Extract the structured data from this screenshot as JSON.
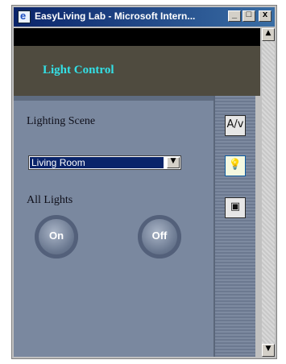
{
  "window": {
    "title": "EasyLiving Lab - Microsoft Intern...",
    "controls": {
      "minimize": "_",
      "maximize": "□",
      "close": "x"
    }
  },
  "header": {
    "title": "Light Control"
  },
  "lighting": {
    "scene_label": "Lighting Scene",
    "selected_scene": "Living Room",
    "all_lights_label": "All Lights",
    "on_label": "On",
    "off_label": "Off"
  },
  "tools": [
    {
      "icon": "audio-video-icon",
      "glyph": "A/v"
    },
    {
      "icon": "lightbulb-icon",
      "glyph": "💡"
    },
    {
      "icon": "display-icon",
      "glyph": "▣"
    }
  ],
  "scrollbar": {
    "up": "▲",
    "down": "▼"
  },
  "colors": {
    "header_bg": "#4f4b3f",
    "header_text": "#33e0e6",
    "panel_bg": "#7a889f",
    "selection": "#0a246a"
  }
}
